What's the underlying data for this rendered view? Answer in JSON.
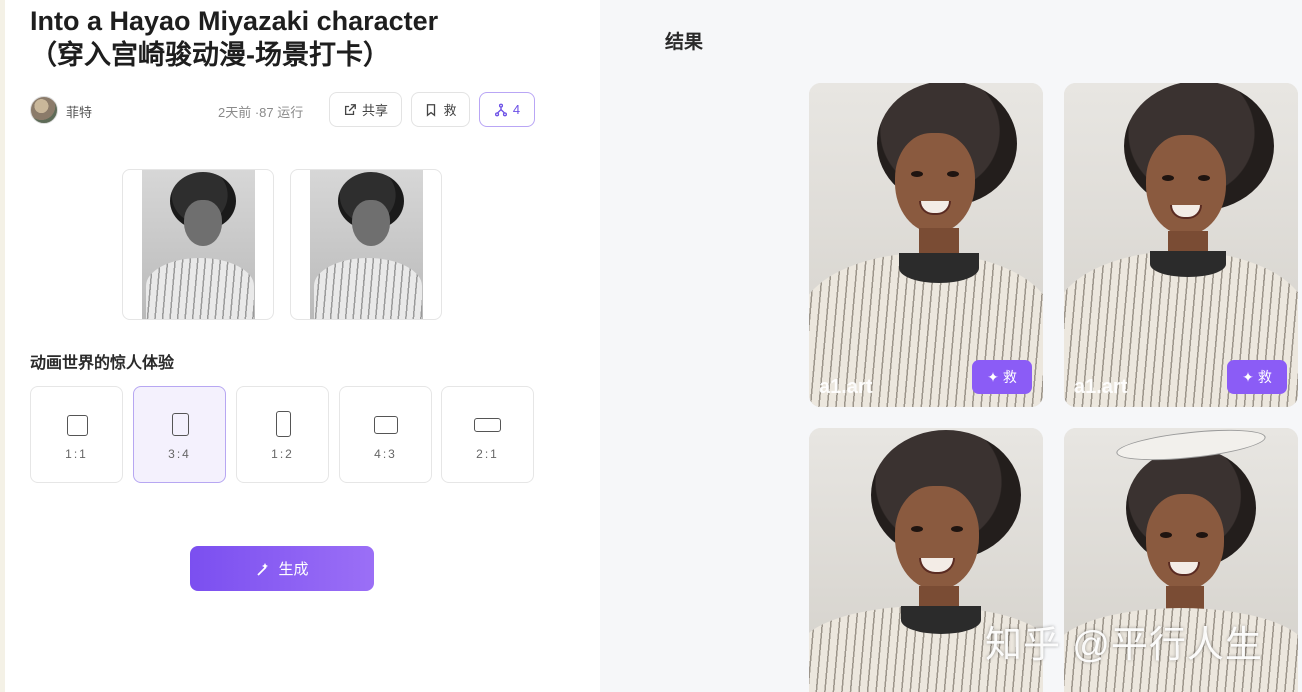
{
  "app": {
    "title_line1": "Into a Hayao Miyazaki character",
    "title_line2": "（穿入宫崎骏动漫-场景打卡）"
  },
  "meta": {
    "author": "菲特",
    "info": "2天前 ·87 运行",
    "share_label": "共享",
    "save_label": "救",
    "fork_count": "4"
  },
  "section_label": "动画世界的惊人体验",
  "ratios": [
    {
      "label": "1:1",
      "selected": false
    },
    {
      "label": "3:4",
      "selected": true
    },
    {
      "label": "1:2",
      "selected": false
    },
    {
      "label": "4:3",
      "selected": false
    },
    {
      "label": "2:1",
      "selected": false
    }
  ],
  "generate_label": "生成",
  "results": {
    "label": "结果",
    "brand": "a1.art",
    "save_badge_label": "救"
  },
  "overlay_watermark": "知乎 @平行人生",
  "colors": {
    "accent": "#8b5cf6",
    "accent_light": "#f4f1fd",
    "panel_bg": "#f6f7f9"
  }
}
